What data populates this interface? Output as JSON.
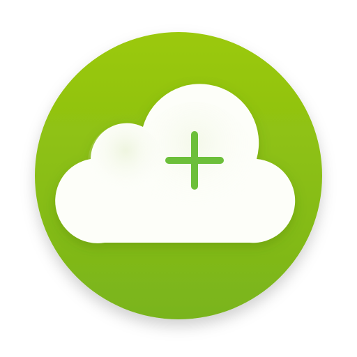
{
  "app_icon": {
    "icon_name": "cloud-add-icon",
    "colors": {
      "circle_top": "#9bc90d",
      "circle_bottom": "#79b41c",
      "cloud": "#fdfef9",
      "cloud_shade": "#e8f1d4",
      "plus": "#6cbf3a"
    }
  }
}
